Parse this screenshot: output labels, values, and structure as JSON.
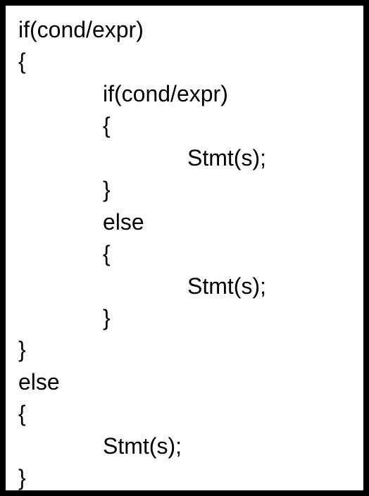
{
  "code": {
    "lines": [
      {
        "text": "if(cond/expr)",
        "indent": 0
      },
      {
        "text": "{",
        "indent": 0
      },
      {
        "text": "if(cond/expr)",
        "indent": 1
      },
      {
        "text": "{",
        "indent": 1
      },
      {
        "text": "Stmt(s);",
        "indent": 2
      },
      {
        "text": "}",
        "indent": 1
      },
      {
        "text": "else",
        "indent": 1
      },
      {
        "text": "{",
        "indent": 1
      },
      {
        "text": "Stmt(s);",
        "indent": 2
      },
      {
        "text": "}",
        "indent": 1
      },
      {
        "text": "}",
        "indent": 0
      },
      {
        "text": "else",
        "indent": 0
      },
      {
        "text": "{",
        "indent": 0
      },
      {
        "text": "Stmt(s);",
        "indent": 1
      },
      {
        "text": "}",
        "indent": 0
      }
    ]
  }
}
